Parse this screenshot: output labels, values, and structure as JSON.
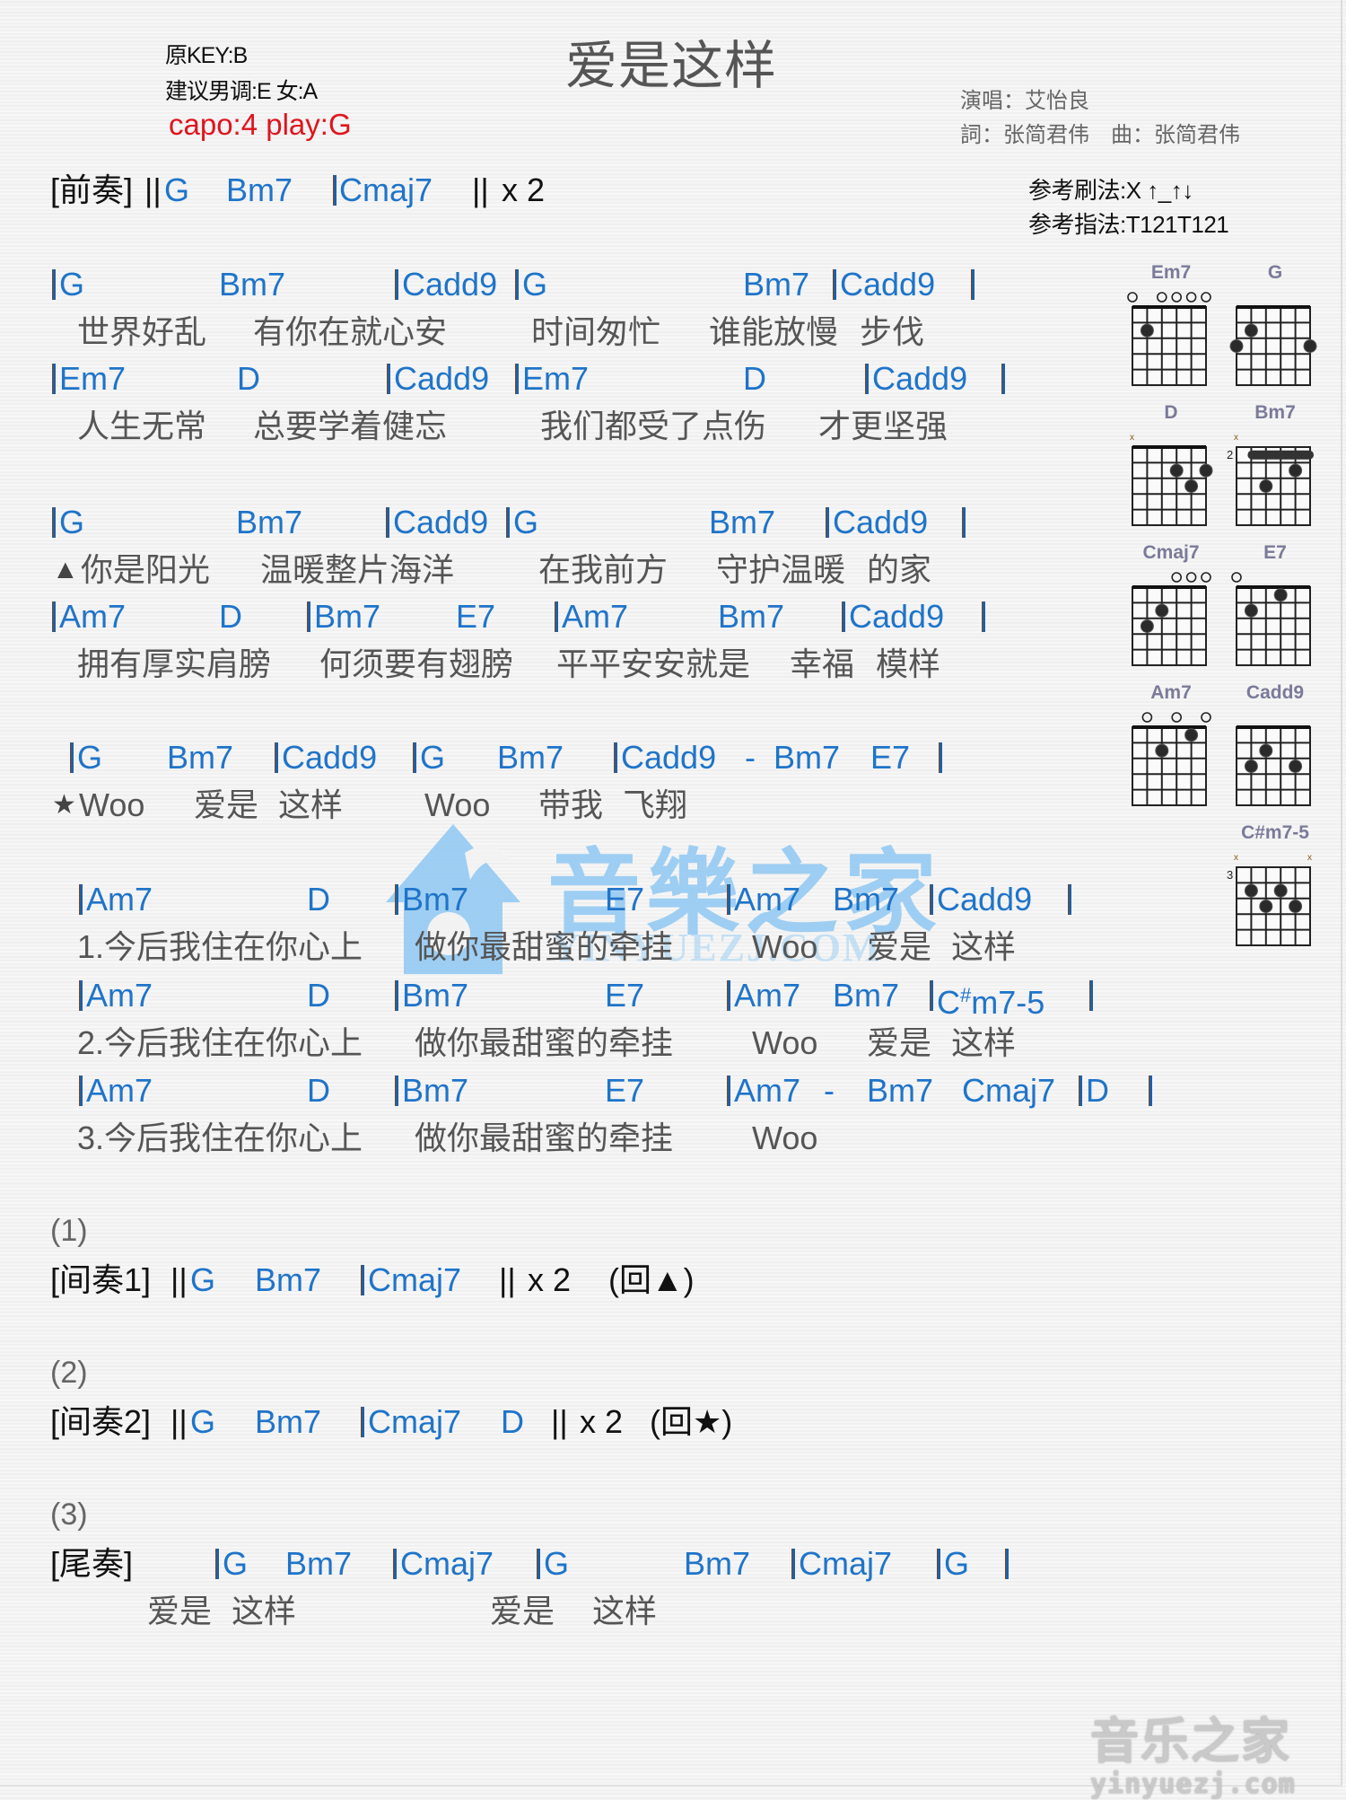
{
  "header": {
    "original_key": "原KEY:B",
    "suggested_key": "建议男调:E 女:A",
    "capo": "capo:4 play:G",
    "title": "爱是这样",
    "singer": "演唱：艾怡良",
    "lyricist_composer": "詞：张简君伟　曲：张简君伟",
    "strum_pattern": "参考刷法:X ↑_↑↓",
    "finger_pattern": "参考指法:T121T121"
  },
  "intro": {
    "label": "[前奏]",
    "open_repeat": "||",
    "chords": [
      "G",
      "Bm7",
      "Cmaj7"
    ],
    "close_repeat": "||",
    "repeat": "x 2"
  },
  "verse": {
    "chord_lines": [
      [
        "G",
        "Bm7",
        "Cadd9",
        "G",
        "Bm7",
        "Cadd9"
      ],
      [
        "Em7",
        "D",
        "Cadd9",
        "Em7",
        "D",
        "Cadd9"
      ]
    ],
    "lyric_lines": [
      [
        "世界好乱",
        "有你在就心安",
        "时间匆忙",
        "谁能放慢",
        "步伐"
      ],
      [
        "人生无常",
        "总要学着健忘",
        "我们都受了点伤",
        "才更坚强"
      ]
    ]
  },
  "pre_chorus": {
    "marker": "▲",
    "chord_lines": [
      [
        "G",
        "Bm7",
        "Cadd9",
        "G",
        "Bm7",
        "Cadd9"
      ],
      [
        "Am7",
        "D",
        "Bm7",
        "E7",
        "Am7",
        "Bm7",
        "Cadd9"
      ]
    ],
    "lyric_lines": [
      [
        "你是阳光",
        "温暖整片海洋",
        "在我前方",
        "守护温暖",
        "的家"
      ],
      [
        "拥有厚实肩膀",
        "何须要有翅膀",
        "平平安安就是",
        "幸福",
        "模样"
      ]
    ]
  },
  "chorus": {
    "marker": "★",
    "chords": [
      "G",
      "Bm7",
      "Cadd9",
      "G",
      "Bm7",
      "Cadd9",
      "-",
      "Bm7",
      "E7"
    ],
    "lyrics": [
      "Woo",
      "爱是",
      "这样",
      "Woo",
      "带我",
      "飞翔"
    ]
  },
  "endings": [
    {
      "chords": [
        "Am7",
        "D",
        "Bm7",
        "E7",
        "Am7",
        "Bm7",
        "Cadd9"
      ],
      "lyrics": [
        "1.今后我住在你心上",
        "做你最甜蜜的牵挂",
        "Woo",
        "爱是",
        "这样"
      ]
    },
    {
      "chords": [
        "Am7",
        "D",
        "Bm7",
        "E7",
        "Am7",
        "Bm7",
        "C#m7-5"
      ],
      "lyrics": [
        "2.今后我住在你心上",
        "做你最甜蜜的牵挂",
        "Woo",
        "爱是",
        "这样"
      ]
    },
    {
      "chords": [
        "Am7",
        "D",
        "Bm7",
        "E7",
        "Am7",
        "-",
        "Bm7",
        "Cmaj7",
        "D"
      ],
      "lyrics": [
        "3.今后我住在你心上",
        "做你最甜蜜的牵挂",
        "Woo"
      ]
    }
  ],
  "interlude1": {
    "number": "(1)",
    "label": "[间奏1]",
    "open_repeat": "||",
    "chords": [
      "G",
      "Bm7",
      "Cmaj7"
    ],
    "close_repeat": "||",
    "repeat": "x 2",
    "goto": "(回▲)"
  },
  "interlude2": {
    "number": "(2)",
    "label": "[间奏2]",
    "open_repeat": "||",
    "chords": [
      "G",
      "Bm7",
      "Cmaj7",
      "D"
    ],
    "close_repeat": "||",
    "repeat": "x 2",
    "goto": "(回★)"
  },
  "outro": {
    "number": "(3)",
    "label": "[尾奏]",
    "chords": [
      "G",
      "Bm7",
      "Cmaj7",
      "G",
      "Bm7",
      "Cmaj7",
      "G"
    ],
    "lyrics": [
      "爱是",
      "这样",
      "爱是",
      "这样"
    ]
  },
  "chord_diagrams": [
    {
      "name": "Em7",
      "base_fret": "",
      "strings": [
        "o",
        "",
        "o",
        "o",
        "o",
        "o"
      ],
      "dots": [
        [
          2,
          2
        ]
      ],
      "barre": null
    },
    {
      "name": "G",
      "base_fret": "",
      "strings": [
        "",
        "",
        "",
        "",
        "",
        ""
      ],
      "dots": [
        [
          2,
          2
        ],
        [
          1,
          3
        ],
        [
          6,
          3
        ]
      ],
      "barre": null
    },
    {
      "name": "D",
      "base_fret": "",
      "strings": [
        "x",
        "",
        "",
        "",
        "",
        ""
      ],
      "dots": [
        [
          4,
          2
        ],
        [
          6,
          2
        ],
        [
          5,
          3
        ]
      ],
      "barre": null
    },
    {
      "name": "Bm7",
      "base_fret": "2",
      "strings": [
        "x",
        "",
        "",
        "",
        "",
        ""
      ],
      "dots": [
        [
          5,
          2
        ],
        [
          3,
          3
        ]
      ],
      "barre": [
        2,
        6,
        1
      ]
    },
    {
      "name": "Cmaj7",
      "base_fret": "",
      "strings": [
        "",
        "",
        "",
        "o",
        "o",
        "o"
      ],
      "dots": [
        [
          3,
          2
        ],
        [
          2,
          3
        ]
      ],
      "barre": null
    },
    {
      "name": "E7",
      "base_fret": "",
      "strings": [
        "o",
        "",
        "",
        "",
        "",
        ""
      ],
      "dots": [
        [
          4,
          1
        ],
        [
          2,
          2
        ]
      ],
      "barre": null
    },
    {
      "name": "Am7",
      "base_fret": "",
      "strings": [
        "",
        "o",
        "",
        "o",
        "",
        "o"
      ],
      "dots": [
        [
          5,
          1
        ],
        [
          3,
          2
        ]
      ],
      "barre": null
    },
    {
      "name": "Cadd9",
      "base_fret": "",
      "strings": [
        "",
        "",
        "",
        "",
        "",
        ""
      ],
      "dots": [
        [
          3,
          2
        ],
        [
          2,
          3
        ],
        [
          5,
          3
        ]
      ],
      "barre": null
    },
    {
      "name": "C#m7-5",
      "base_fret": "3",
      "strings": [
        "x",
        "",
        "",
        "",
        "",
        "x"
      ],
      "dots": [
        [
          2,
          2
        ],
        [
          4,
          2
        ],
        [
          3,
          3
        ],
        [
          5,
          3
        ]
      ],
      "barre": null
    }
  ],
  "watermark": {
    "brand": "音樂之家",
    "site": "YINYUEZJ.COM"
  },
  "corner_logo": {
    "brand": "音乐之家",
    "site": "yinyuezj.com"
  },
  "colors": {
    "chord": "#1f74c9",
    "capo": "#e0141e",
    "lyric": "#555555",
    "watermark": "#8fc8f3"
  }
}
